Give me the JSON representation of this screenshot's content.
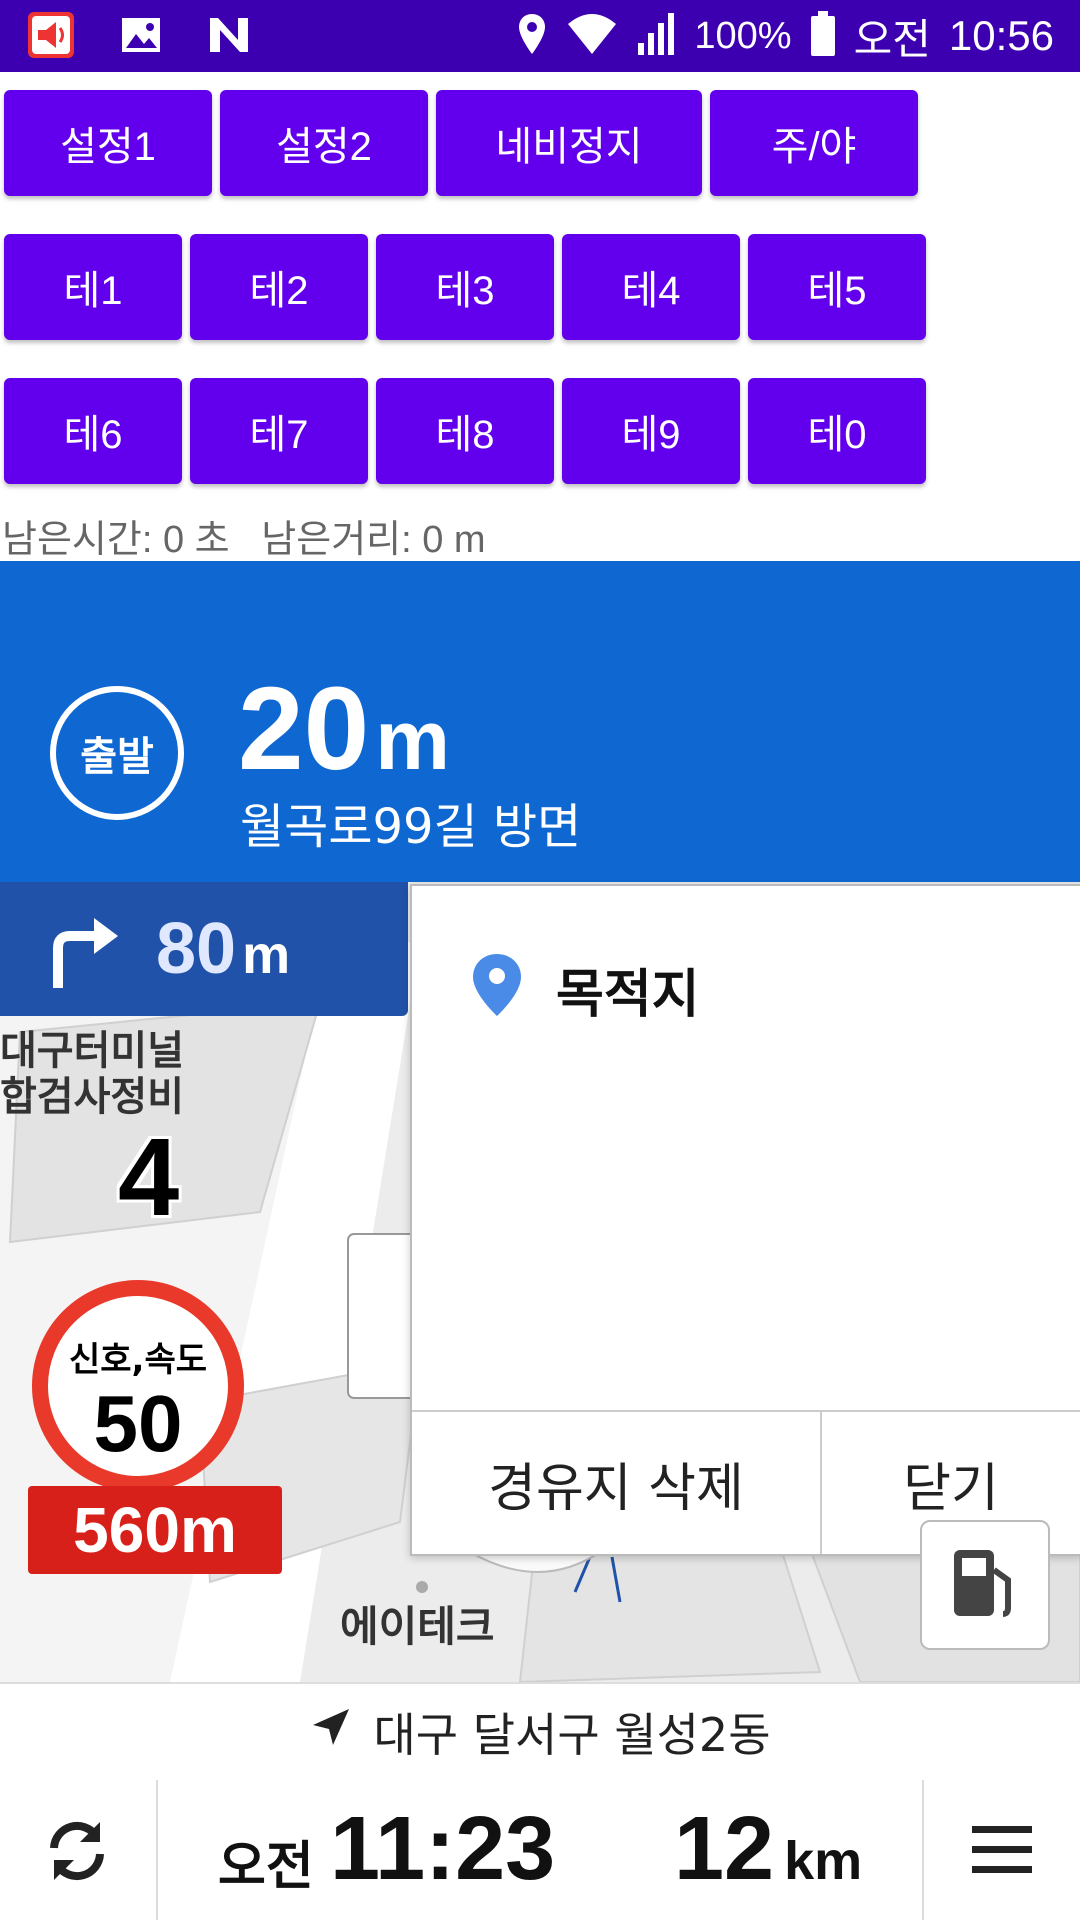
{
  "statusbar": {
    "battery": "100%",
    "ampm": "오전",
    "time": "10:56"
  },
  "buttons_row1": [
    "설정1",
    "설정2",
    "네비정지",
    "주/야"
  ],
  "buttons_row2": [
    "테1",
    "테2",
    "테3",
    "테4",
    "테5"
  ],
  "buttons_row3": [
    "테6",
    "테7",
    "테8",
    "테9",
    "테0"
  ],
  "remaining": {
    "text": "남은시간: 0 초   남은거리: 0 m"
  },
  "guidance": {
    "badge": "출발",
    "distance_value": "20",
    "distance_unit": "m",
    "direction": "월곡로99길 방면"
  },
  "next_turn": {
    "value": "80",
    "unit": "m"
  },
  "map": {
    "poi_1_line1": "대구터미널",
    "poi_1_line2": "합검사정비",
    "lane_number": "4",
    "poi_2": "에이테크"
  },
  "speed_sign": {
    "caption": "신호,속도",
    "limit": "50",
    "distance": "560m"
  },
  "popup": {
    "title": "목적지",
    "delete_label": "경유지 삭제",
    "close_label": "닫기"
  },
  "address": "대구 달서구 월성2동",
  "bottom": {
    "ampm": "오전",
    "arrival_time": "11:23",
    "remaining_value": "12",
    "remaining_unit": "km"
  },
  "colors": {
    "statusbar": "#3d00b0",
    "button": "#6200ee",
    "banner": "#0f68d2",
    "next_turn": "#1f52a8",
    "speed_border": "#e8392b",
    "speed_distance": "#d8201a"
  },
  "icons": [
    "volume-icon",
    "image-icon",
    "n-app-icon",
    "location-icon",
    "wifi-icon",
    "signal-icon",
    "battery-icon",
    "turn-right-arrow-icon",
    "map-pin-icon",
    "fuel-icon",
    "navigation-arrow-icon",
    "refresh-icon",
    "menu-icon"
  ]
}
